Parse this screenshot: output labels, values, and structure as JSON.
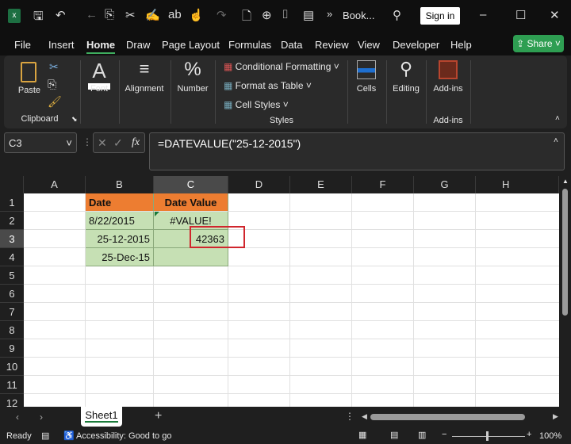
{
  "title_bar": {
    "title": "Book...",
    "sign_in": "Sign in",
    "overflow": "»"
  },
  "menu": {
    "tabs": [
      "File",
      "Insert",
      "Home",
      "Draw",
      "Page Layout",
      "Formulas",
      "Data",
      "Review",
      "View",
      "Developer",
      "Help"
    ],
    "active": "Home",
    "share": "Share"
  },
  "ribbon": {
    "paste": "Paste",
    "clipboard": "Clipboard",
    "font": "Font",
    "alignment": "Alignment",
    "number": "Number",
    "conditional_formatting": "Conditional Formatting",
    "format_as_table": "Format as Table",
    "cell_styles": "Cell Styles",
    "styles": "Styles",
    "cells": "Cells",
    "editing": "Editing",
    "addins": "Add-ins",
    "addins_group": "Add-ins"
  },
  "formula_bar": {
    "name_box": "C3",
    "fx": "fx",
    "formula": "=DATEVALUE(\"25-12-2015\")"
  },
  "columns": [
    "A",
    "B",
    "C",
    "D",
    "E",
    "F",
    "G",
    "H"
  ],
  "rows": [
    "1",
    "2",
    "3",
    "4",
    "5",
    "6",
    "7",
    "8",
    "9",
    "10",
    "11",
    "12"
  ],
  "cells": {
    "B1": "Date",
    "C1": "Date Value",
    "B2": "8/22/2015",
    "C2": "#VALUE!",
    "B3": "25-12-2015",
    "C3": "42363",
    "B4": "25-Dec-15"
  },
  "selected_cell": "C3",
  "colors": {
    "header_fill": "#ed7d31",
    "data_fill": "#c6e0b4",
    "highlight_box": "#d0262d",
    "share": "#2e9e52"
  },
  "sheets": [
    "Sheet1"
  ],
  "status": {
    "ready": "Ready",
    "accessibility": "Accessibility: Good to go",
    "zoom": "100%"
  }
}
